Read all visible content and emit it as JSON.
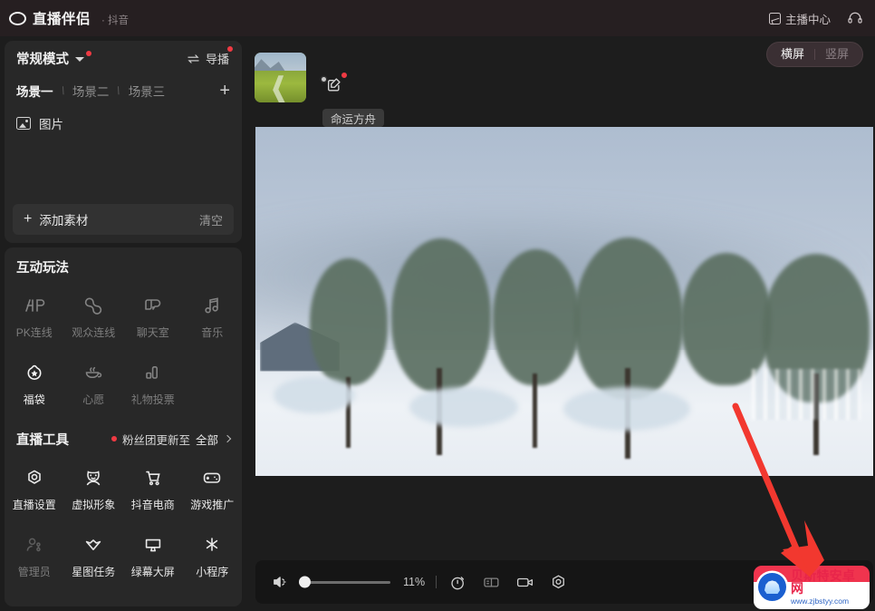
{
  "titlebar": {
    "brand": "直播伴侣",
    "brand_sub": "· 抖音",
    "logo_icon": "ring-logo-icon",
    "anchor_center_label": "主播中心",
    "anchor_center_icon": "chart-icon",
    "headset_icon": "headset-icon"
  },
  "scene_panel": {
    "mode_label": "常规模式",
    "mode_caret_icon": "chevron-down-icon",
    "direct_label": "导播",
    "direct_icon": "swap-arrows-icon",
    "tabs": [
      {
        "label": "场景一",
        "active": true
      },
      {
        "label": "场景二",
        "active": false
      },
      {
        "label": "场景三",
        "active": false
      }
    ],
    "tab_separator": "\\",
    "add_scene_icon": "plus-icon",
    "layers": [
      {
        "label": "图片",
        "icon": "image-icon"
      }
    ],
    "add_material_label": "添加素材",
    "add_material_icon": "plus-icon",
    "clear_label": "清空"
  },
  "interaction_panel": {
    "title": "互动玩法",
    "items": [
      {
        "label": "PK连线",
        "icon": "pk-icon",
        "dim": true
      },
      {
        "label": "观众连线",
        "icon": "audience-link-icon",
        "dim": true
      },
      {
        "label": "聊天室",
        "icon": "chatroom-icon",
        "dim": true
      },
      {
        "label": "音乐",
        "icon": "music-note-icon",
        "dim": true
      },
      {
        "label": "福袋",
        "icon": "lucky-bag-icon",
        "dim": false
      },
      {
        "label": "心愿",
        "icon": "wish-icon",
        "dim": true
      },
      {
        "label": "礼物投票",
        "icon": "gift-vote-icon",
        "dim": true
      }
    ]
  },
  "tools_panel": {
    "title": "直播工具",
    "note_prefix": "粉丝团更新至",
    "note_value": "全部",
    "note_dot_color": "#ef3a43",
    "note_chevron_icon": "chevron-right-icon",
    "items": [
      {
        "label": "直播设置",
        "icon": "live-settings-icon",
        "dim": false
      },
      {
        "label": "虚拟形象",
        "icon": "avatar-icon",
        "dim": false
      },
      {
        "label": "抖音电商",
        "icon": "shopping-cart-icon",
        "dim": false
      },
      {
        "label": "游戏推广",
        "icon": "gamepad-icon",
        "dim": false
      },
      {
        "label": "管理员",
        "icon": "admin-user-icon",
        "dim": true
      },
      {
        "label": "星图任务",
        "icon": "star-map-icon",
        "dim": false
      },
      {
        "label": "绿幕大屏",
        "icon": "monitor-icon",
        "dim": false
      },
      {
        "label": "小程序",
        "icon": "mini-program-icon",
        "dim": false
      }
    ]
  },
  "preview": {
    "thumbnail_name": "game-cover-thumbnail",
    "live_dot_icon": "status-dot-icon",
    "edit_icon": "edit-square-icon",
    "game_tag": "命运方舟",
    "orientation": {
      "options": [
        {
          "label": "横屏",
          "active": true
        },
        {
          "label": "竖屏",
          "active": false
        }
      ]
    },
    "video_name": "snowy-landscape-preview"
  },
  "bottombar": {
    "mute_icon": "speaker-muted-icon",
    "volume_percent": "11%",
    "volume_value": 11,
    "controls": [
      {
        "icon": "timer-icon",
        "name": "timer-button",
        "dim": false
      },
      {
        "icon": "split-screen-icon",
        "name": "split-screen-button",
        "dim": true
      },
      {
        "icon": "camera-icon",
        "name": "camera-button",
        "dim": false
      },
      {
        "icon": "gear-icon",
        "name": "settings-button",
        "dim": false
      }
    ]
  },
  "annotation": {
    "arrow_color": "#f2382f",
    "arrow_name": "red-pointer-arrow"
  },
  "watermark": {
    "title": "贝斯特安卓网",
    "url": "www.zjbstyy.com",
    "badge_icon": "shell-logo-icon",
    "bg_color": "#f0344e"
  }
}
